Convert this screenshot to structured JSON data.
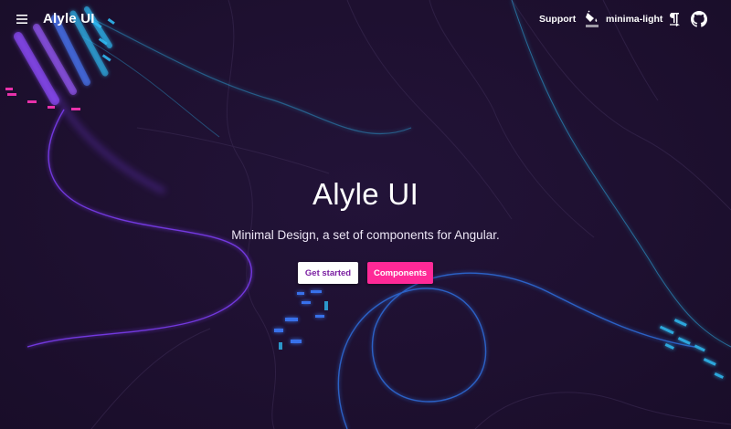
{
  "header": {
    "brand": "Alyle UI",
    "support_label": "Support",
    "theme_label": "minima-light"
  },
  "hero": {
    "title": "Alyle UI",
    "subtitle": "Minimal Design, a set of components for Angular.",
    "primary_button": "Get started",
    "secondary_button": "Components"
  },
  "icons": {
    "menu": "menu-icon",
    "theme": "paint-bucket-icon",
    "direction": "text-direction-icon",
    "github": "github-icon"
  },
  "colors": {
    "background": "#1e1030",
    "accent_pink": "#ff2997",
    "primary_text_on_white": "#7b1fa2",
    "cyan": "#2fb8f0",
    "purple": "#8a3cf0"
  }
}
